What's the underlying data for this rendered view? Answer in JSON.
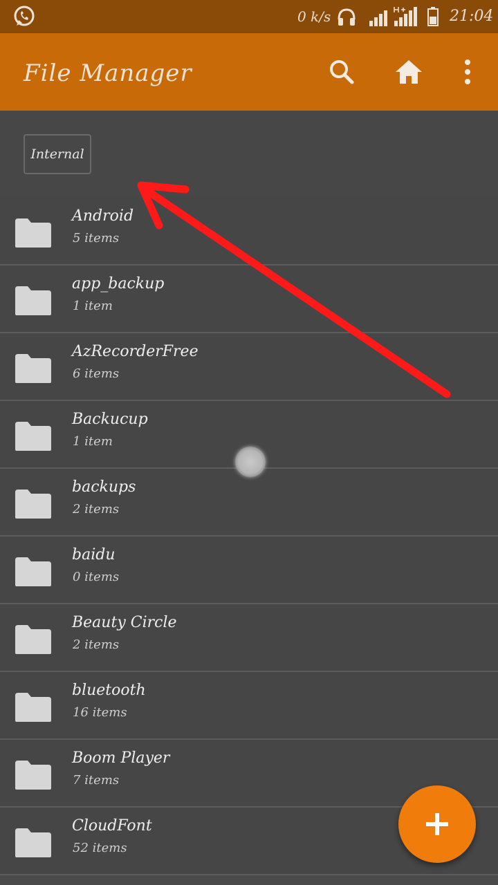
{
  "status_bar": {
    "net_speed": "0 k/s",
    "time": "21:04",
    "icons": [
      "whatsapp-icon",
      "headset-icon",
      "signal-icon",
      "signal-hplus-icon",
      "battery-icon"
    ]
  },
  "app_bar": {
    "title": "File Manager",
    "icons": [
      "search-icon",
      "home-icon",
      "more-vertical-icon"
    ]
  },
  "path": {
    "current": "Internal"
  },
  "files": [
    {
      "name": "Android",
      "count": "5 items"
    },
    {
      "name": "app_backup",
      "count": "1 item"
    },
    {
      "name": "AzRecorderFree",
      "count": "6 items"
    },
    {
      "name": "Backucup",
      "count": "1 item"
    },
    {
      "name": "backups",
      "count": "2 items"
    },
    {
      "name": "baidu",
      "count": "0 items"
    },
    {
      "name": "Beauty Circle",
      "count": "2 items"
    },
    {
      "name": "bluetooth",
      "count": "16 items"
    },
    {
      "name": "Boom Player",
      "count": "7 items"
    },
    {
      "name": "CloudFont",
      "count": "52 items"
    }
  ],
  "fab": {
    "icon": "plus-icon"
  },
  "colors": {
    "status_bar": "#8a4b08",
    "app_bar": "#c86a08",
    "background": "#4a4a4a",
    "fab": "#f07c0b",
    "annotation": "#ff1a1a"
  }
}
